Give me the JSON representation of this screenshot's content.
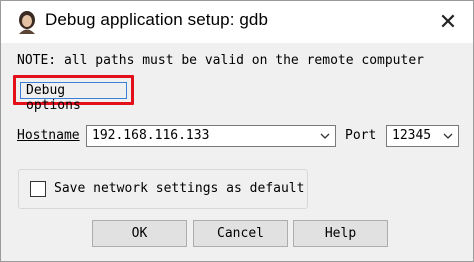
{
  "window": {
    "title": "Debug application setup: gdb",
    "close_glyph": "✕",
    "app_icon": "person-avatar-icon"
  },
  "note": "NOTE: all paths must be valid on the remote computer",
  "debug_options_label": "Debug options",
  "hostname": {
    "label": "Hostname",
    "value": "192.168.116.133"
  },
  "port": {
    "label": "Port",
    "value": "12345"
  },
  "save_default": {
    "label": "Save network settings as default",
    "checked": false
  },
  "buttons": {
    "ok": "OK",
    "cancel": "Cancel",
    "help": "Help"
  },
  "colors": {
    "highlight_border": "#e3101c",
    "focus_border": "#3c7fd6"
  }
}
